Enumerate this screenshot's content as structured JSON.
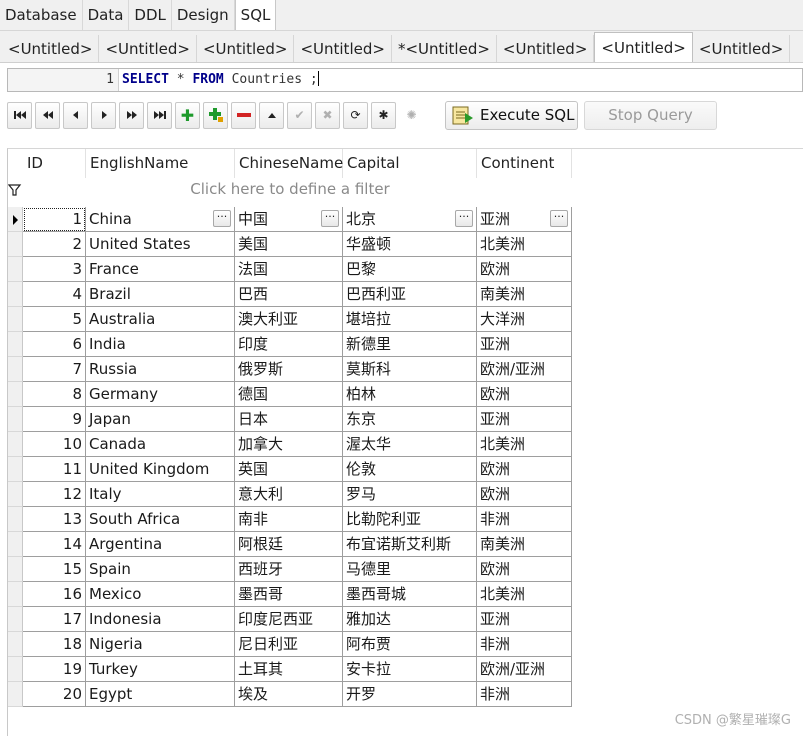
{
  "top_tabs": [
    "Database",
    "Data",
    "DDL",
    "Design",
    "SQL"
  ],
  "top_active": "SQL",
  "query_tabs": [
    "<Untitled>",
    "<Untitled>",
    "<Untitled>",
    "<Untitled>",
    "*<Untitled>",
    "<Untitled>",
    "<Untitled>",
    "<Untitled>"
  ],
  "editor": {
    "line_number": "1",
    "sql_keyword_1": "SELECT",
    "sql_star": " * ",
    "sql_keyword_2": "FROM",
    "sql_rest": " Countries ;"
  },
  "toolbar": {
    "buttons": [
      "first-record",
      "prev-page",
      "prev-record",
      "next-record",
      "next-page",
      "last-record",
      "insert-record",
      "insert-clone",
      "delete-record",
      "post-up",
      "post-edit",
      "cancel-edit",
      "refresh",
      "star",
      "sparkle"
    ],
    "execute_label": "Execute SQL",
    "stop_label": "Stop Query"
  },
  "grid": {
    "columns": [
      "ID",
      "EnglishName",
      "ChineseName",
      "Capital",
      "Continent"
    ],
    "filter_placeholder": "Click here to define a filter",
    "rows": [
      [
        "1",
        "China",
        "中国",
        "北京",
        "亚洲"
      ],
      [
        "2",
        "United States",
        "美国",
        "华盛顿",
        "北美洲"
      ],
      [
        "3",
        "France",
        "法国",
        "巴黎",
        "欧洲"
      ],
      [
        "4",
        "Brazil",
        "巴西",
        "巴西利亚",
        "南美洲"
      ],
      [
        "5",
        "Australia",
        "澳大利亚",
        "堪培拉",
        "大洋洲"
      ],
      [
        "6",
        "India",
        "印度",
        "新德里",
        "亚洲"
      ],
      [
        "7",
        "Russia",
        "俄罗斯",
        "莫斯科",
        "欧洲/亚洲"
      ],
      [
        "8",
        "Germany",
        "德国",
        "柏林",
        "欧洲"
      ],
      [
        "9",
        "Japan",
        "日本",
        "东京",
        "亚洲"
      ],
      [
        "10",
        "Canada",
        "加拿大",
        "渥太华",
        "北美洲"
      ],
      [
        "11",
        "United Kingdom",
        "英国",
        "伦敦",
        "欧洲"
      ],
      [
        "12",
        "Italy",
        "意大利",
        "罗马",
        "欧洲"
      ],
      [
        "13",
        "South Africa",
        "南非",
        "比勒陀利亚",
        "非洲"
      ],
      [
        "14",
        "Argentina",
        "阿根廷",
        "布宜诺斯艾利斯",
        "南美洲"
      ],
      [
        "15",
        "Spain",
        "西班牙",
        "马德里",
        "欧洲"
      ],
      [
        "16",
        "Mexico",
        "墨西哥",
        "墨西哥城",
        "北美洲"
      ],
      [
        "17",
        "Indonesia",
        "印度尼西亚",
        "雅加达",
        "亚洲"
      ],
      [
        "18",
        "Nigeria",
        "尼日利亚",
        "阿布贾",
        "非洲"
      ],
      [
        "19",
        "Turkey",
        "土耳其",
        "安卡拉",
        "欧洲/亚洲"
      ],
      [
        "20",
        "Egypt",
        "埃及",
        "开罗",
        "非洲"
      ]
    ],
    "ellipsis": "···"
  },
  "watermark": "CSDN @繁星璀璨G"
}
